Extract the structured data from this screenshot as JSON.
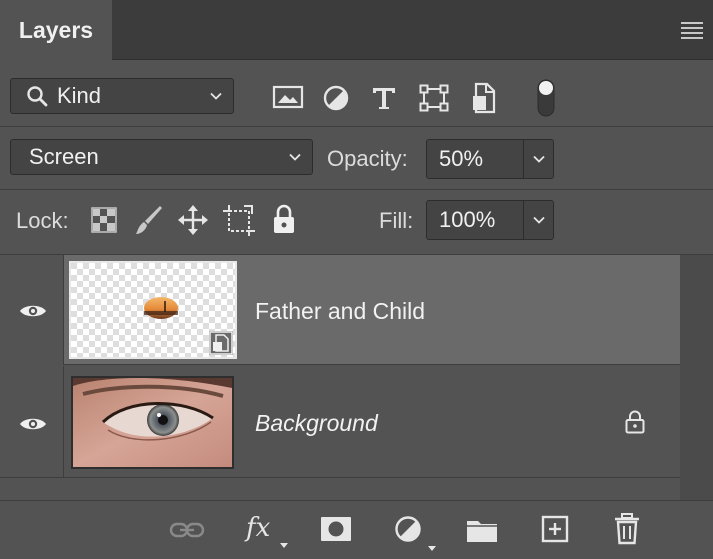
{
  "panel": {
    "tab_title": "Layers",
    "menu_icon": "panel-menu-icon"
  },
  "filter": {
    "kind_label": "Kind",
    "icons": [
      "image-filter-icon",
      "adjustment-filter-icon",
      "type-filter-icon",
      "shape-filter-icon",
      "smart-object-filter-icon",
      "filter-toggle-icon"
    ]
  },
  "blend": {
    "mode": "Screen",
    "opacity_label": "Opacity:",
    "opacity_value": "50%"
  },
  "lock": {
    "label": "Lock:",
    "icons": [
      "lock-transparent-pixels-icon",
      "lock-image-pixels-icon",
      "lock-position-icon",
      "lock-artboard-icon",
      "lock-all-icon"
    ],
    "fill_label": "Fill:",
    "fill_value": "100%"
  },
  "layers": [
    {
      "name": "Father and Child",
      "visible": true,
      "selected": true,
      "smart_object": true,
      "locked": false
    },
    {
      "name": "Background",
      "visible": true,
      "selected": false,
      "smart_object": false,
      "locked": true
    }
  ],
  "bottom_toolbar": {
    "fx_label": "fx",
    "icons": [
      "link-layers-icon",
      "layer-style-icon",
      "add-mask-icon",
      "adjustment-layer-icon",
      "new-group-icon",
      "new-layer-icon",
      "delete-layer-icon"
    ]
  },
  "colors": {
    "panel_bg": "#535353",
    "selected_row": "#6a6a6a",
    "field_bg": "#444444"
  }
}
